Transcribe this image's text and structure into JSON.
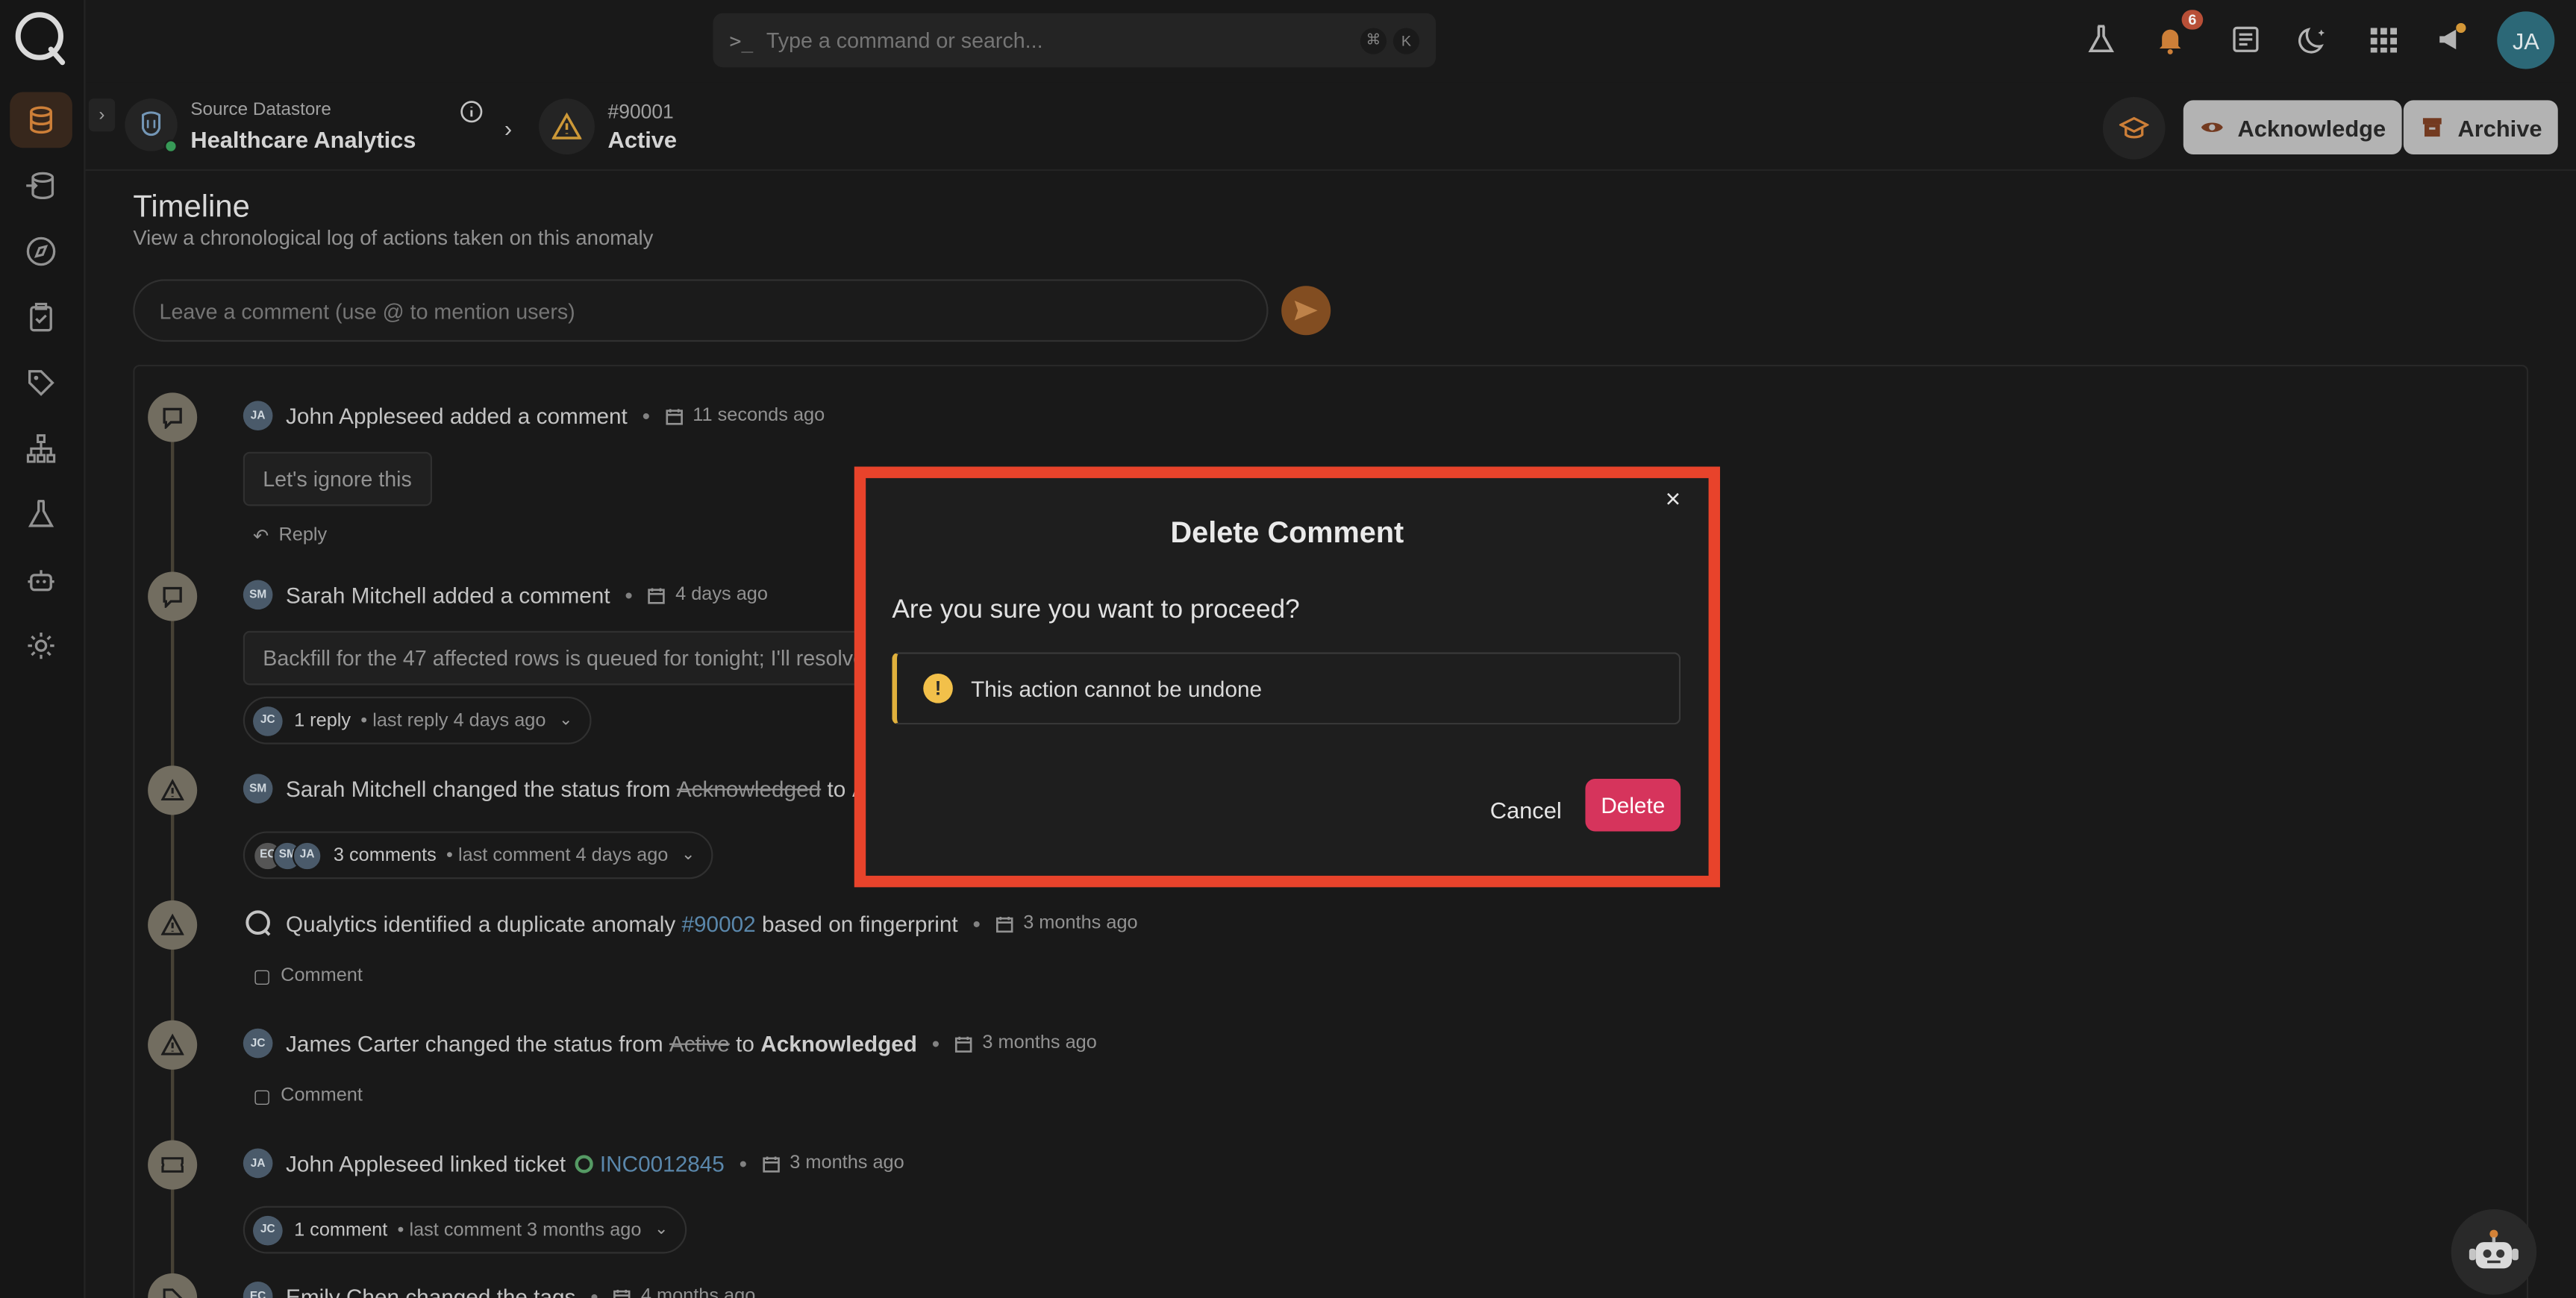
{
  "search": {
    "placeholder": "Type a command or search...",
    "prompt_icon": ">_",
    "shortcut_keys": [
      "⌘",
      "K"
    ]
  },
  "topbar": {
    "notification_count": "6",
    "avatar_initials": "JA"
  },
  "breadcrumb": {
    "datastore_label": "Source Datastore",
    "datastore_name": "Healthcare Analytics",
    "anomaly_id": "#90001",
    "anomaly_status": "Active"
  },
  "header_buttons": {
    "acknowledge": "Acknowledge",
    "archive": "Archive"
  },
  "timeline": {
    "title": "Timeline",
    "subtitle": "View a chronological log of actions taken on this anomaly",
    "comment_placeholder": "Leave a comment (use @ to mention users)"
  },
  "events": [
    {
      "avatar": "JA",
      "actor": "John Appleseed",
      "action": "added a comment",
      "time": "11 seconds ago",
      "comment": "Let's ignore this",
      "reply_label": "Reply"
    },
    {
      "avatar": "SM",
      "actor": "Sarah Mitchell",
      "action": "added a comment",
      "time": "4 days ago",
      "comment": "Backfill for the 47 affected rows is queued for tonight; I'll resolve",
      "pill_avatar": "JC",
      "pill_count": "1 reply",
      "pill_meta": "last reply 4 days ago"
    },
    {
      "avatar": "SM",
      "actor": "Sarah Mitchell",
      "action": "changed the status from",
      "from": "Acknowledged",
      "to_word": "to",
      "to": "Ac",
      "pill_avatars": [
        "EC",
        "SM",
        "JA"
      ],
      "pill_count": "3 comments",
      "pill_meta": "last comment 4 days ago"
    },
    {
      "actor": "Qualytics",
      "action": "identified a duplicate anomaly",
      "link": "#90002",
      "suffix": "based on fingerprint",
      "time": "3 months ago",
      "comment_label": "Comment"
    },
    {
      "avatar": "JC",
      "actor": "James Carter",
      "action": "changed the status from",
      "from": "Active",
      "to_word": "to",
      "to": "Acknowledged",
      "time": "3 months ago",
      "comment_label": "Comment"
    },
    {
      "avatar": "JA",
      "actor": "John Appleseed",
      "action": "linked ticket",
      "link": "INC0012845",
      "time": "3 months ago",
      "pill_avatar": "JC",
      "pill_count": "1 comment",
      "pill_meta": "last comment 3 months ago"
    },
    {
      "avatar": "EC",
      "actor": "Emily Chen",
      "action": "changed the tags",
      "time": "4 months ago"
    }
  ],
  "modal": {
    "title": "Delete Comment",
    "question": "Are you sure you want to proceed?",
    "warning": "This action cannot be undone",
    "cancel": "Cancel",
    "delete": "Delete",
    "close": "×"
  },
  "colors": {
    "accent": "#8a5223",
    "danger": "#d6345c",
    "warning": "#f2c04a",
    "highlight_frame": "#e8432b",
    "link": "#5f8fb5"
  }
}
